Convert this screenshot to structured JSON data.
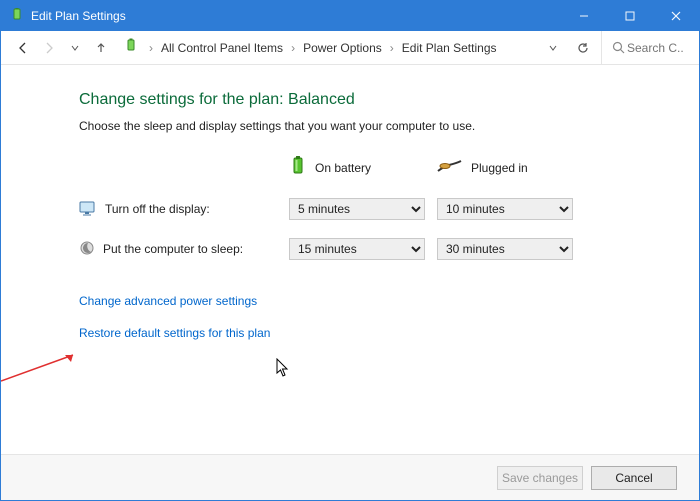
{
  "window": {
    "title": "Edit Plan Settings"
  },
  "breadcrumb": {
    "items": [
      "All Control Panel Items",
      "Power Options",
      "Edit Plan Settings"
    ]
  },
  "search": {
    "placeholder": "Search C..."
  },
  "page": {
    "heading": "Change settings for the plan: Balanced",
    "subheading": "Choose the sleep and display settings that you want your computer to use."
  },
  "columns": {
    "battery": "On battery",
    "plugged": "Plugged in"
  },
  "rows": {
    "display": {
      "label": "Turn off the display:",
      "battery_value": "5 minutes",
      "plugged_value": "10 minutes"
    },
    "sleep": {
      "label": "Put the computer to sleep:",
      "battery_value": "15 minutes",
      "plugged_value": "30 minutes"
    }
  },
  "links": {
    "advanced": "Change advanced power settings",
    "restore": "Restore default settings for this plan"
  },
  "footer": {
    "save": "Save changes",
    "cancel": "Cancel"
  }
}
